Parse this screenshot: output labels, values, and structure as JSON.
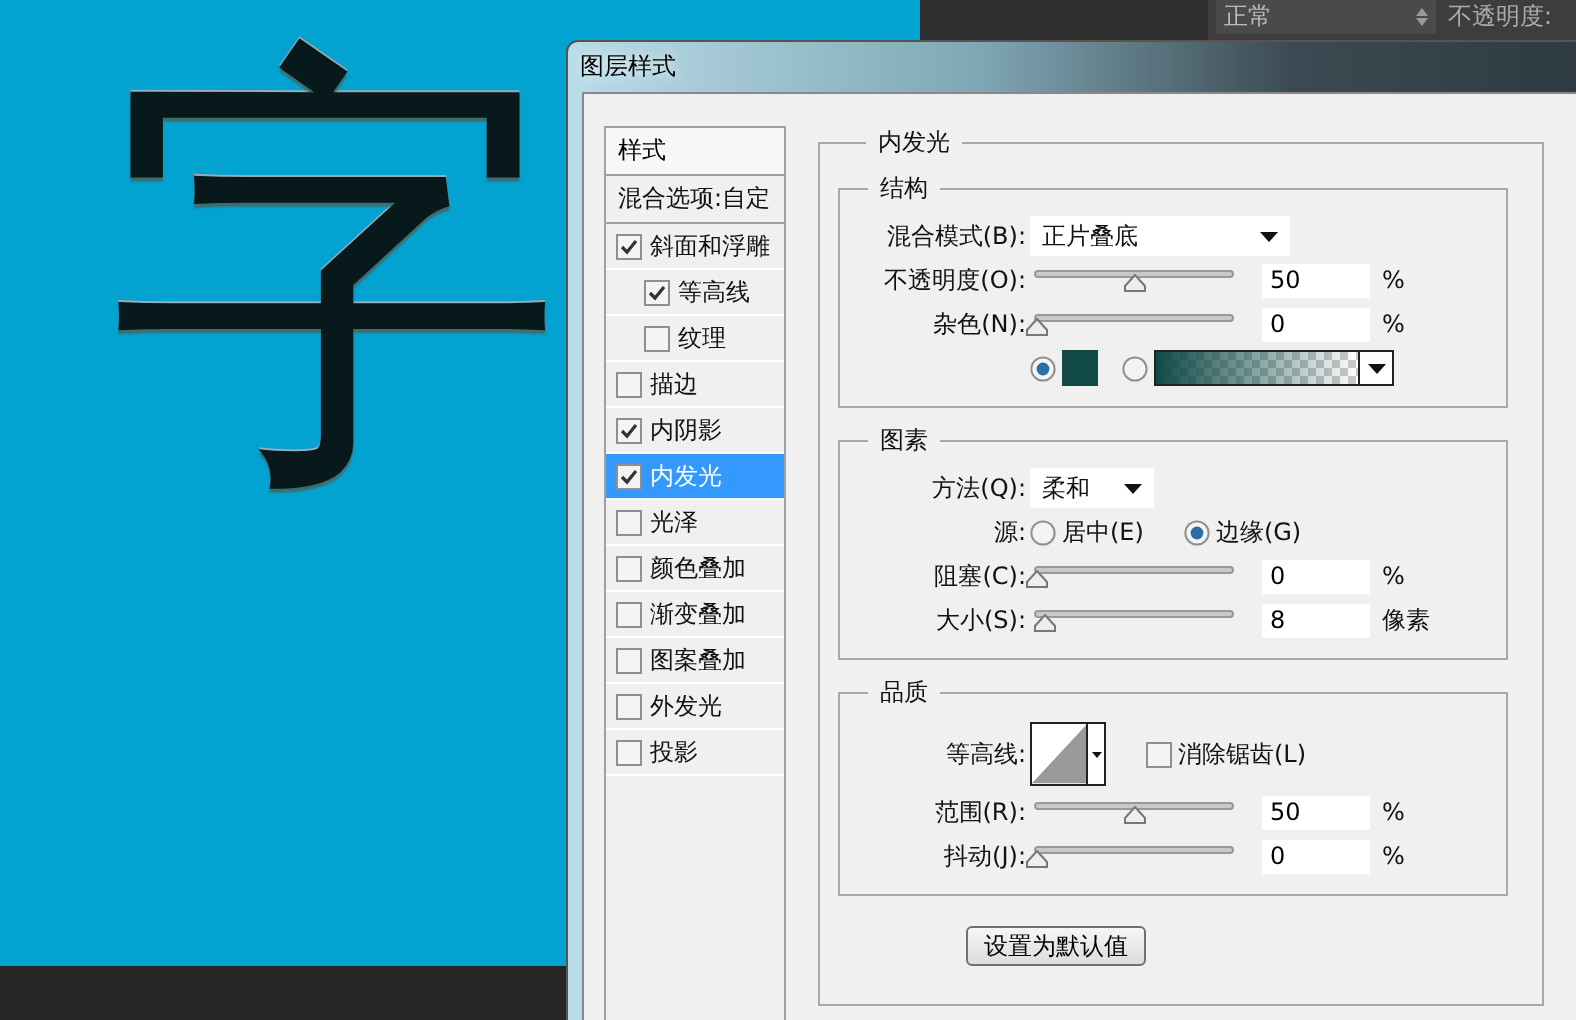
{
  "canvas": {
    "text": "字"
  },
  "top_bar": {
    "blend_mode": "正常",
    "opacity_label": "不透明度:"
  },
  "dialog": {
    "title": "图层样式"
  },
  "styles": {
    "header": "样式",
    "items": [
      {
        "label": "混合选项:自定",
        "kind": "plain",
        "selected": false
      },
      {
        "label": "斜面和浮雕",
        "kind": "check",
        "checked": true,
        "selected": false,
        "children": [
          {
            "label": "等高线",
            "kind": "check",
            "checked": true,
            "selected": false
          },
          {
            "label": "纹理",
            "kind": "check",
            "checked": false,
            "selected": false
          }
        ]
      },
      {
        "label": "描边",
        "kind": "check",
        "checked": false,
        "selected": false
      },
      {
        "label": "内阴影",
        "kind": "check",
        "checked": true,
        "selected": false
      },
      {
        "label": "内发光",
        "kind": "check",
        "checked": true,
        "selected": true
      },
      {
        "label": "光泽",
        "kind": "check",
        "checked": false,
        "selected": false
      },
      {
        "label": "颜色叠加",
        "kind": "check",
        "checked": false,
        "selected": false
      },
      {
        "label": "渐变叠加",
        "kind": "check",
        "checked": false,
        "selected": false
      },
      {
        "label": "图案叠加",
        "kind": "check",
        "checked": false,
        "selected": false
      },
      {
        "label": "外发光",
        "kind": "check",
        "checked": false,
        "selected": false
      },
      {
        "label": "投影",
        "kind": "check",
        "checked": false,
        "selected": false
      }
    ]
  },
  "panel": {
    "title": "内发光",
    "groups": [
      {
        "title": "结构",
        "rows": [
          {
            "kind": "select",
            "label": "混合模式(B):",
            "value": "正片叠底"
          },
          {
            "kind": "slider",
            "label": "不透明度(O):",
            "level": 0.5,
            "value": "50",
            "unit": "%"
          },
          {
            "kind": "slider",
            "label": "杂色(N):",
            "level": 0,
            "value": "0",
            "unit": "%"
          },
          {
            "kind": "fill",
            "options": [
              {
                "kind": "color",
                "selected": true,
                "color": "#0f4a47"
              },
              {
                "kind": "gradient",
                "selected": false
              }
            ]
          }
        ]
      },
      {
        "title": "图素",
        "rows": [
          {
            "kind": "select",
            "label": "方法(Q):",
            "value": "柔和"
          },
          {
            "kind": "radio",
            "label": "源:",
            "options": [
              {
                "label": "居中(E)",
                "selected": false
              },
              {
                "label": "边缘(G)",
                "selected": true
              }
            ]
          },
          {
            "kind": "slider",
            "label": "阻塞(C):",
            "level": 0,
            "value": "0",
            "unit": "%"
          },
          {
            "kind": "slider",
            "label": "大小(S):",
            "level": 0.04,
            "value": "8",
            "unit": "像素"
          }
        ]
      },
      {
        "title": "品质",
        "rows": [
          {
            "kind": "contour",
            "label": "等高线:",
            "checkbox": {
              "label": "消除锯齿(L)",
              "checked": false
            }
          },
          {
            "kind": "slider",
            "label": "范围(R):",
            "level": 0.5,
            "value": "50",
            "unit": "%"
          },
          {
            "kind": "slider",
            "label": "抖动(J):",
            "level": 0,
            "value": "0",
            "unit": "%"
          }
        ]
      }
    ],
    "default_button": "设置为默认值"
  }
}
